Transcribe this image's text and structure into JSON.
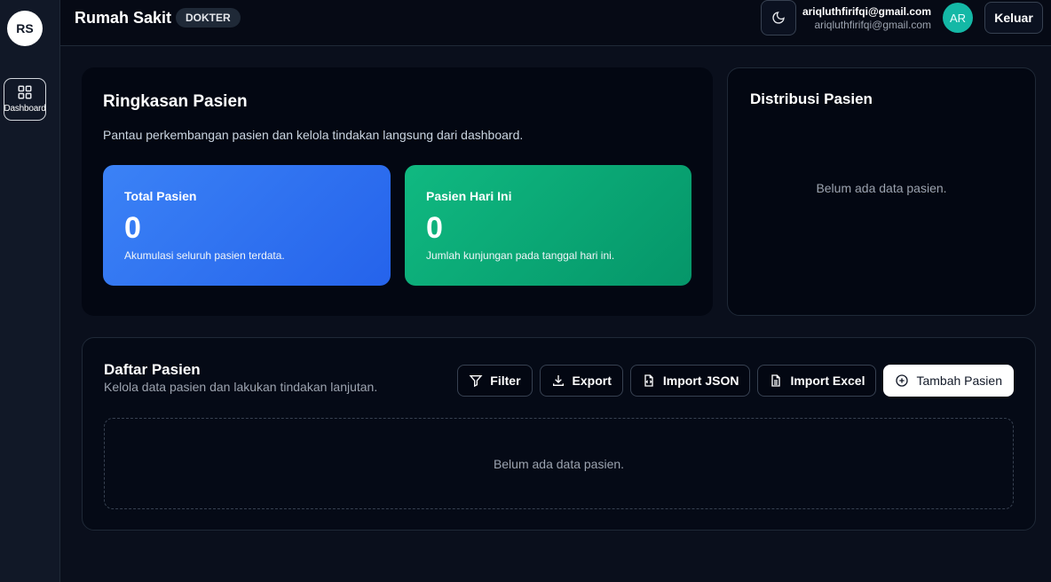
{
  "sidebar": {
    "logo": "RS",
    "items": [
      {
        "label": "Dashboard",
        "icon": "grid-icon"
      }
    ]
  },
  "header": {
    "title": "Rumah Sakit",
    "role_badge": "DOKTER",
    "theme_icon": "moon-icon",
    "user_name": "ariqluthfirifqi@gmail.com",
    "user_email": "ariqluthfirifqi@gmail.com",
    "avatar_initials": "AR",
    "logout_label": "Keluar"
  },
  "summary": {
    "title": "Ringkasan Pasien",
    "description": "Pantau perkembangan pasien dan kelola tindakan langsung dari dashboard.",
    "stats": [
      {
        "title": "Total Pasien",
        "value": "0",
        "subtitle": "Akumulasi seluruh pasien terdata.",
        "color": "#3b82f6"
      },
      {
        "title": "Pasien Hari Ini",
        "value": "0",
        "subtitle": "Jumlah kunjungan pada tanggal hari ini.",
        "color": "#10b981"
      }
    ]
  },
  "distribution": {
    "title": "Distribusi Pasien",
    "empty_text": "Belum ada data pasien."
  },
  "patients": {
    "title": "Daftar Pasien",
    "subtitle": "Kelola data pasien dan lakukan tindakan lanjutan.",
    "buttons": {
      "filter": "Filter",
      "export": "Export",
      "import_json": "Import JSON",
      "import_excel": "Import Excel",
      "add": "Tambah Pasien"
    },
    "empty_text": "Belum ada data pasien."
  }
}
